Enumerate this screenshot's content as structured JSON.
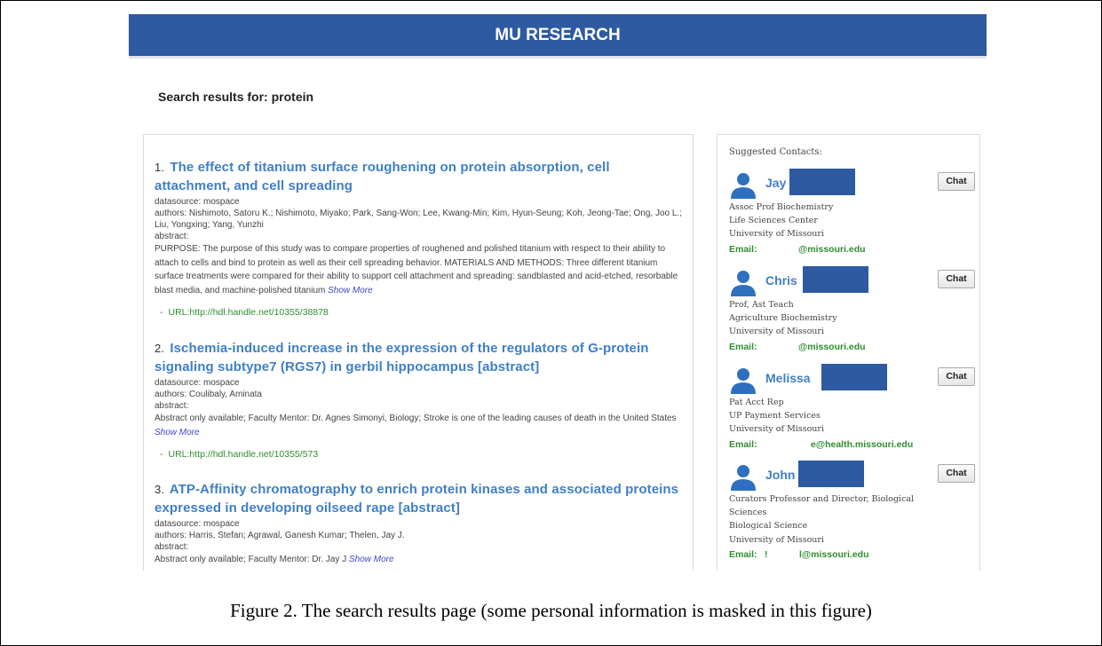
{
  "header": {
    "title": "MU RESEARCH"
  },
  "search": {
    "heading": "Search results for: protein"
  },
  "results": [
    {
      "number": "1.",
      "title": "The effect of titanium surface roughening on protein absorption, cell attachment, and cell spreading",
      "datasource": "datasource: mospace",
      "authors": "authors: Nishimoto, Satoru K.; Nishimoto, Miyako; Park, Sang-Won; Lee, Kwang-Min; Kim, Hyun-Seung; Koh, Jeong-Tae; Ong, Joo L.; Liu, Yongxing; Yang, Yunzhi",
      "abstract_label": "abstract:",
      "abstract": "PURPOSE: The purpose of this study was to compare properties of roughened and polished titanium with respect to their ability to attach to cells and bind to protein as well as their cell spreading behavior. MATERIALS AND METHODS: Three different titanium surface treatments were compared for their ability to support cell attachment and spreading: sandblasted and acid-etched, resorbable blast media, and machine-polished titanium",
      "show_more": "Show More",
      "url": "URL:http://hdl.handle.net/10355/38878"
    },
    {
      "number": "2.",
      "title": "Ischemia-induced increase in the expression of the regulators of G-protein signaling subtype7 (RGS7) in gerbil hippocampus [abstract]",
      "datasource": "datasource: mospace",
      "authors": "authors: Coulibaly, Aminata",
      "abstract_label": "abstract:",
      "abstract": "Abstract only available; Faculty Mentor: Dr. Agnes Simonyi, Biology; Stroke is one of the leading causes of death in the United States",
      "show_more": "Show More",
      "url": "URL:http://hdl.handle.net/10355/573"
    },
    {
      "number": "3.",
      "title": "ATP-Affinity chromatography to enrich protein kinases and associated proteins expressed in developing oilseed rape [abstract]",
      "datasource": "datasource: mospace",
      "authors": "authors: Harris, Stefan; Agrawal, Ganesh Kumar; Thelen, Jay J.",
      "abstract_label": "abstract:",
      "abstract": "Abstract only available; Faculty Mentor: Dr. Jay J",
      "show_more": "Show More",
      "url": ""
    }
  ],
  "contacts": {
    "heading": "Suggested Contacts:",
    "chat_label": "Chat",
    "email_label": "Email:",
    "items": [
      {
        "name": "Jay",
        "title": "Assoc Prof Biochemistry",
        "dept": "Life Sciences Center",
        "org": "University of Missouri",
        "email_prefix": "",
        "email": "@missouri.edu"
      },
      {
        "name": "Chris",
        "title": "Prof, Ast Teach",
        "dept": "Agriculture Biochemistry",
        "org": "University of Missouri",
        "email_prefix": "",
        "email": "@missouri.edu"
      },
      {
        "name": "Melissa",
        "title": "Pat Acct Rep",
        "dept": "UP Payment Services",
        "org": "University of Missouri",
        "email_prefix": "",
        "email": "e@health.missouri.edu"
      },
      {
        "name": "John",
        "title": "Curators Professor and Director, Biological Sciences",
        "dept": "Biological Science",
        "org": "University of Missouri",
        "email_prefix": "!",
        "email": "l@missouri.edu"
      }
    ]
  },
  "caption": "Figure 2. The search results page (some personal information is masked in this figure)",
  "colors": {
    "brand": "#2d5aa0",
    "link": "#3f7fc7",
    "url_green": "#2f8c2f",
    "show_more": "#3a48c8",
    "mask": "#2d5aa0"
  },
  "icons": {
    "avatar": "user-avatar-icon"
  }
}
